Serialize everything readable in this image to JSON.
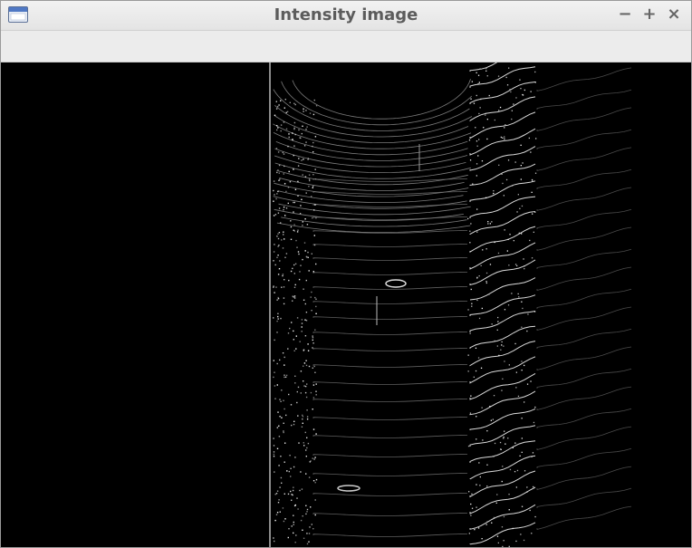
{
  "window": {
    "title": "Intensity image",
    "controls": {
      "minimize": "−",
      "maximize": "+",
      "close": "×"
    },
    "icon": "window-icon"
  },
  "image": {
    "type": "lidar-intensity-image",
    "background": "#000000",
    "foreground": "#ffffff"
  }
}
